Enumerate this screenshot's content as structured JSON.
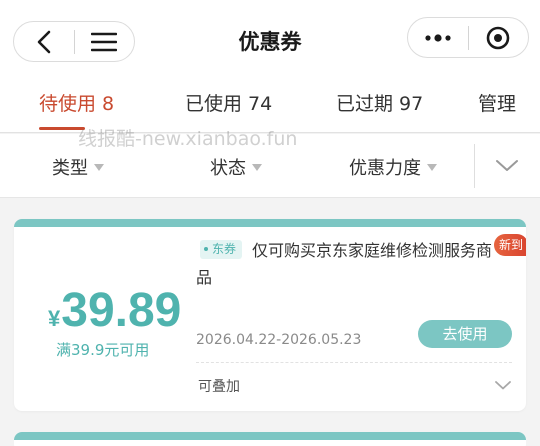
{
  "header": {
    "title": "优惠券",
    "back_icon": "chevron-left-icon",
    "menu_icon": "hamburger-menu-icon",
    "more_icon": "more-dots-icon",
    "record_icon": "target-circle-icon"
  },
  "tabs": [
    {
      "label": "待使用 8",
      "active": true
    },
    {
      "label": "已使用 74",
      "active": false
    },
    {
      "label": "已过期 97",
      "active": false
    },
    {
      "label": "管理",
      "active": false
    }
  ],
  "watermark": "线报酷-new.xianbao.fun",
  "filters": [
    {
      "label": "类型"
    },
    {
      "label": "状态"
    },
    {
      "label": "优惠力度"
    }
  ],
  "coupon": {
    "currency": "¥",
    "amount": "39.89",
    "threshold": "满39.9元可用",
    "source_badge": "东券",
    "description": "仅可购买京东家庭维修检测服务商品",
    "new_badge": "新到",
    "date_range": "2026.04.22-2026.05.23",
    "use_button": "去使用",
    "stackable": "可叠加"
  },
  "colors": {
    "accent_red": "#c94a2f",
    "teal": "#4fb3ae",
    "teal_light": "#7cc6c3"
  }
}
